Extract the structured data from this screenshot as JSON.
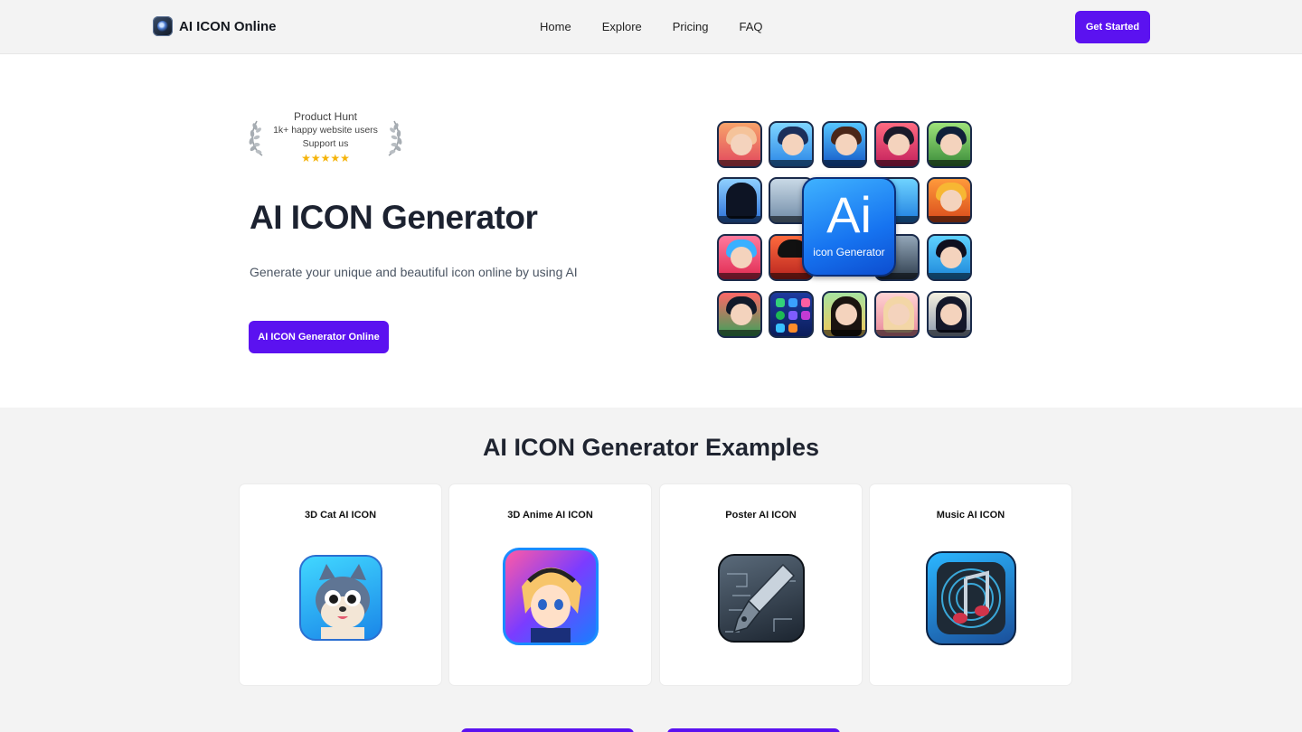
{
  "header": {
    "logo_text": "AI ICON Online",
    "nav": [
      "Home",
      "Explore",
      "Pricing",
      "FAQ"
    ],
    "cta_label": "Get Started"
  },
  "hero": {
    "badge_title": "Product Hunt",
    "badge_line1": "1k+ happy website users",
    "badge_line2": "Support us",
    "stars": "★★★★★",
    "rating_stars": 5,
    "title": "AI ICON Generator",
    "subtitle": "Generate your unique and beautiful icon online by using AI",
    "cta_label": "AI ICON Generator Online",
    "collage_center_big": "Ai",
    "collage_center_small": "icon Generator"
  },
  "examples": {
    "title": "AI ICON Generator Examples",
    "cards": [
      {
        "title": "3D Cat AI ICON",
        "icon": "cat-icon"
      },
      {
        "title": "3D Anime AI ICON",
        "icon": "anime-icon"
      },
      {
        "title": "Poster AI ICON",
        "icon": "pen-nib-icon"
      },
      {
        "title": "Music AI ICON",
        "icon": "music-note-icon"
      }
    ]
  },
  "colors": {
    "accent": "#5b12f0",
    "page_bg": "#f3f3f3",
    "hero_bg": "#ffffff",
    "star": "#f5b40b"
  }
}
